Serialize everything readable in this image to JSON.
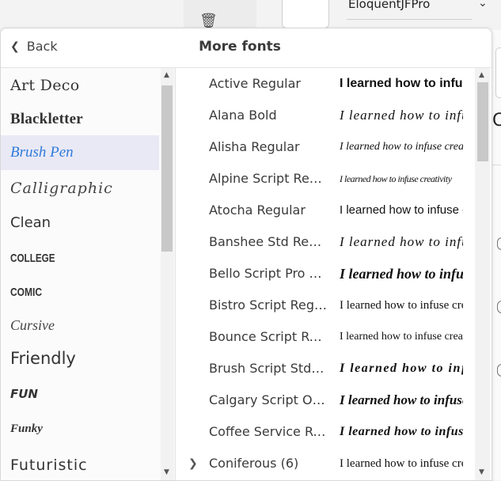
{
  "background": {
    "font_dropdown_value": "EloquentJFPro",
    "trash_icon": "trash-icon"
  },
  "panel": {
    "back_label": "Back",
    "title": "More fonts"
  },
  "categories": [
    {
      "label": "Art Deco",
      "selected": false
    },
    {
      "label": "Blackletter",
      "selected": false
    },
    {
      "label": "Brush Pen",
      "selected": true
    },
    {
      "label": "Calligraphic",
      "selected": false
    },
    {
      "label": "Clean",
      "selected": false
    },
    {
      "label": "COLLEGE",
      "selected": false
    },
    {
      "label": "COMIC",
      "selected": false
    },
    {
      "label": "Cursive",
      "selected": false
    },
    {
      "label": "Friendly",
      "selected": false
    },
    {
      "label": "FUN",
      "selected": false
    },
    {
      "label": "Funky",
      "selected": false
    },
    {
      "label": "Futuristic",
      "selected": false
    }
  ],
  "preview_text": "I learned how to infuse creativity",
  "fonts": [
    {
      "name": "Active Regular"
    },
    {
      "name": "Alana Bold"
    },
    {
      "name": "Alisha Regular"
    },
    {
      "name": "Alpine Script Regular"
    },
    {
      "name": "Atocha Regular"
    },
    {
      "name": "Banshee Std Regular"
    },
    {
      "name": "Bello Script Pro Re..."
    },
    {
      "name": "Bistro Script Regular"
    },
    {
      "name": "Bounce Script Reg..."
    },
    {
      "name": "Brush Script Std M..."
    },
    {
      "name": "Calgary Script OT ..."
    },
    {
      "name": "Coffee Service Reg..."
    },
    {
      "name": "Coniferous (6)",
      "expandable": true
    }
  ],
  "colors": {
    "accent": "#2f7bdc",
    "selected_bg": "#e9e9f5"
  }
}
